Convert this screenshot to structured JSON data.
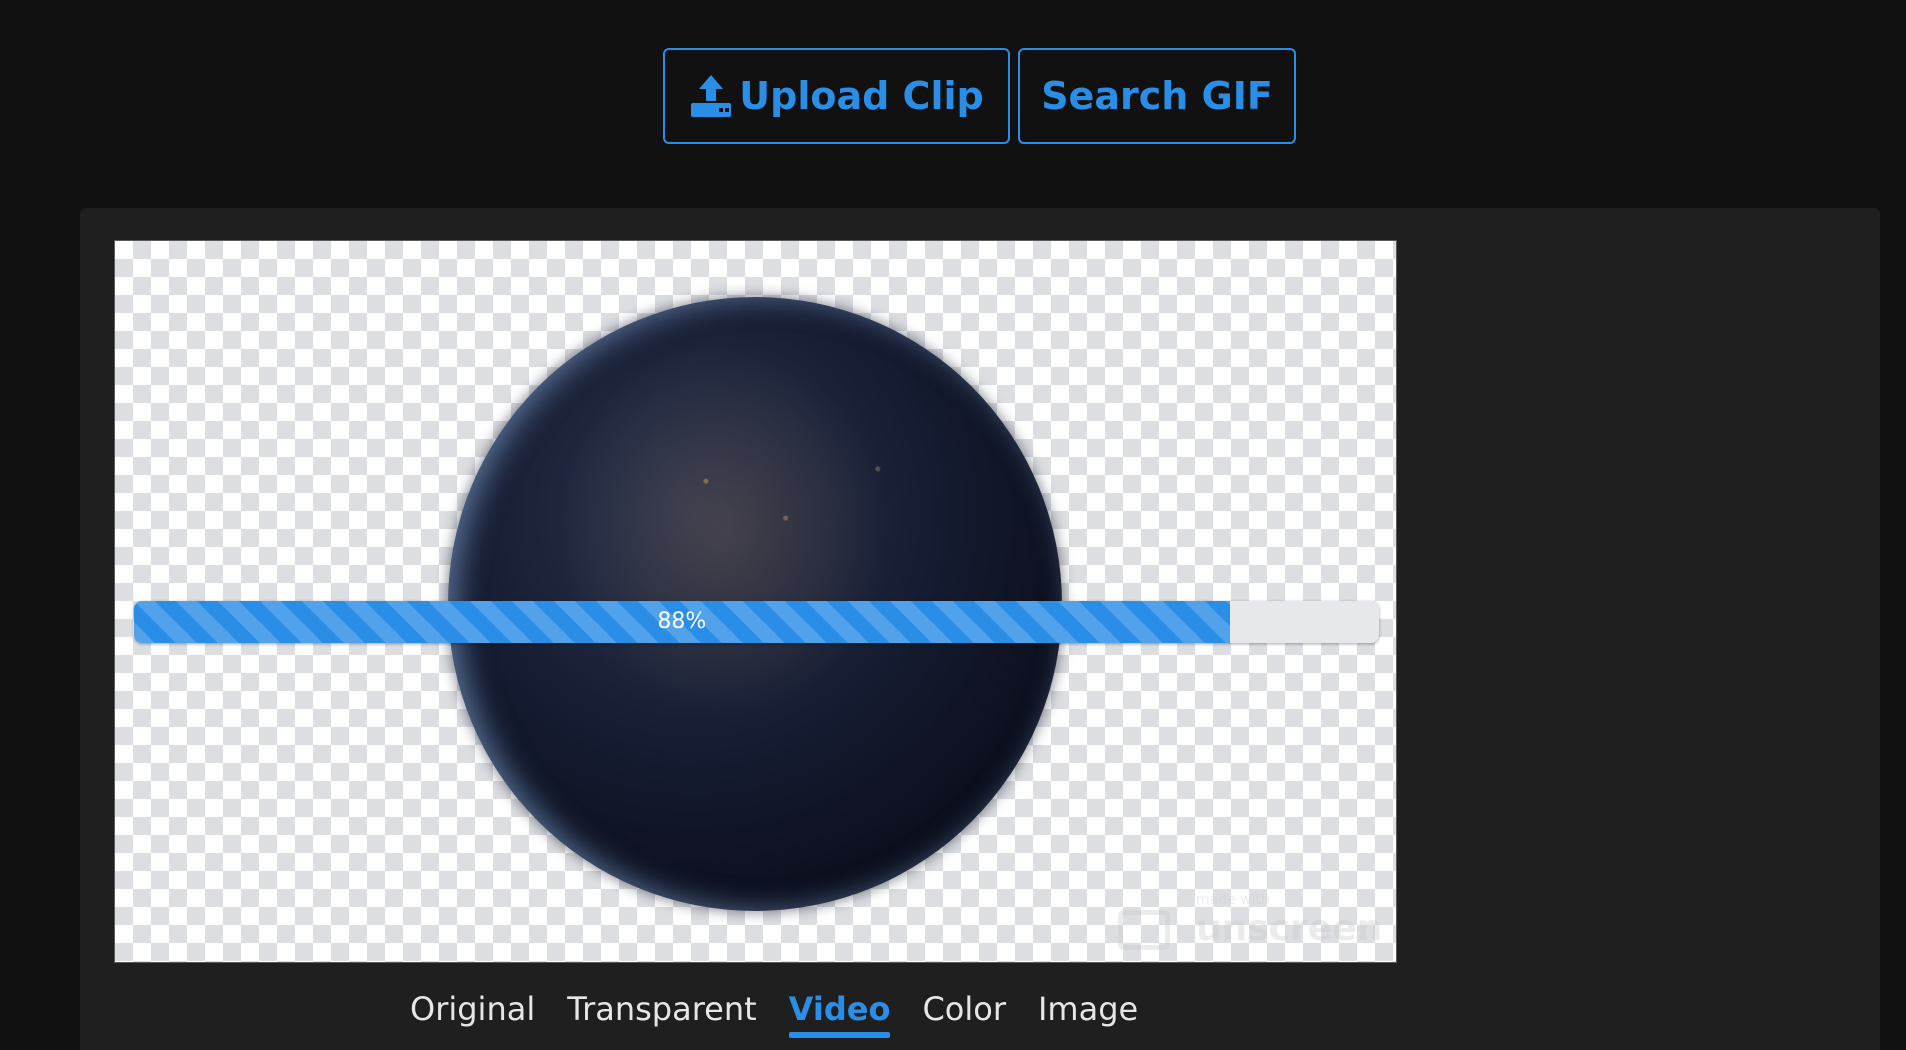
{
  "toolbar": {
    "upload_label": "Upload Clip",
    "upload_icon": "upload-icon",
    "search_label": "Search GIF"
  },
  "preview": {
    "background": "checkerboard-transparent",
    "content": "earth-at-night-globe",
    "watermark": {
      "small_text": "made with",
      "brand_text": "unscreen"
    }
  },
  "progress": {
    "value": 0.88,
    "label": "88%"
  },
  "tabs": [
    {
      "label": "Original",
      "active": false
    },
    {
      "label": "Transparent",
      "active": false
    },
    {
      "label": "Video",
      "active": true
    },
    {
      "label": "Color",
      "active": false
    },
    {
      "label": "Image",
      "active": false
    }
  ],
  "colors": {
    "accent": "#2b8ee6",
    "background": "#111111",
    "panel": "#1f1f1f",
    "tab_text": "#e6e6e6"
  }
}
